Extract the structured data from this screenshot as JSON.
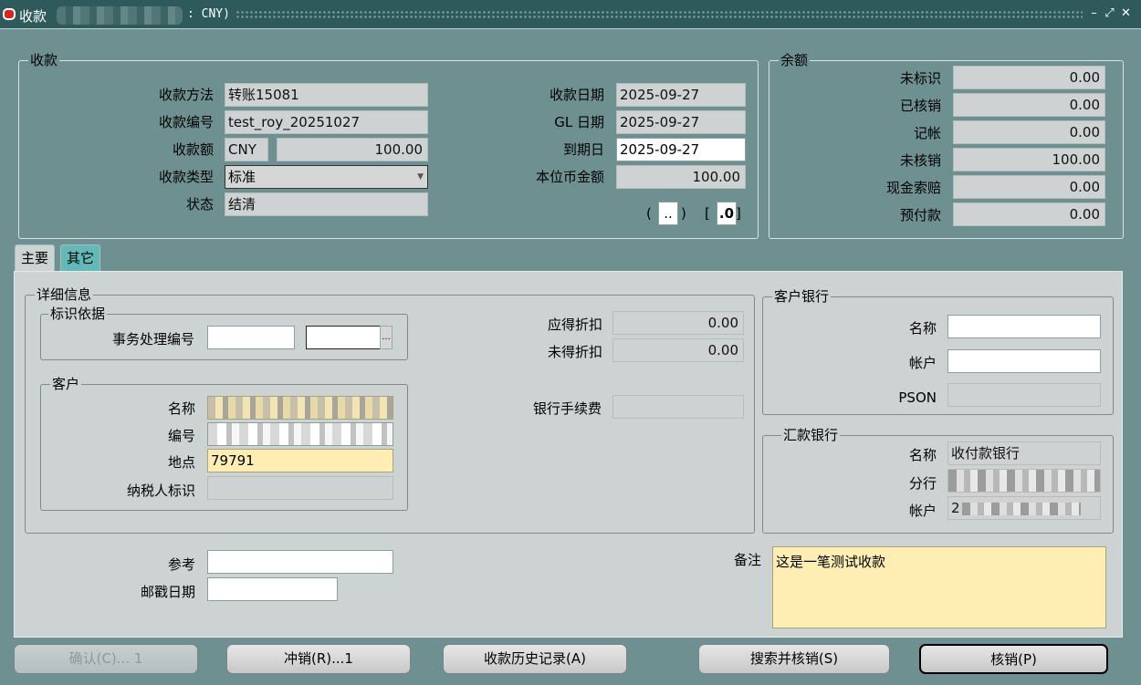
{
  "window": {
    "title": "收款",
    "title_suffix": ": CNY)",
    "controls": [
      "minimize-icon",
      "maximize-icon",
      "close-icon"
    ]
  },
  "receipt": {
    "legend": "收款",
    "method_label": "收款方法",
    "method_value": "转账15081",
    "number_label": "收款编号",
    "number_value": "test_roy_20251027",
    "amount_label": "收款额",
    "currency_value": "CNY",
    "amount_value": "100.00",
    "type_label": "收款类型",
    "type_value": "标准",
    "status_label": "状态",
    "status_value": "结清",
    "receipt_date_label": "收款日期",
    "receipt_date_value": "2025-09-27",
    "gl_date_label": "GL 日期",
    "gl_date_value": "2025-09-27",
    "maturity_date_label": "到期日",
    "maturity_date_value": "2025-09-27",
    "functional_amount_label": "本位币金额",
    "functional_amount_value": "100.00",
    "dff_open": "(",
    "dff_value": "..",
    "dff_close": ")",
    "dff2_open": "[",
    "dff2_value": ".0",
    "dff2_close": "]"
  },
  "balances": {
    "legend": "余额",
    "rows": [
      {
        "label": "未标识",
        "value": "0.00"
      },
      {
        "label": "已核销",
        "value": "0.00"
      },
      {
        "label": "记帐",
        "value": "0.00"
      },
      {
        "label": "未核销",
        "value": "100.00"
      },
      {
        "label": "现金索赔",
        "value": "0.00"
      },
      {
        "label": "预付款",
        "value": "0.00"
      }
    ]
  },
  "tabs": [
    {
      "label": "主要",
      "active": true
    },
    {
      "label": "其它",
      "active": false
    }
  ],
  "details": {
    "legend": "详细信息",
    "identification_legend": "标识依据",
    "transaction_number_label": "事务处理编号",
    "transaction_number_value": "",
    "transaction_number_value2": "",
    "lov_button": "...",
    "customer_legend": "客户",
    "customer_name_label": "名称",
    "customer_number_label": "编号",
    "customer_site_label": "地点",
    "customer_site_value": "79791",
    "taxpayer_label": "纳税人标识",
    "taxpayer_value": "",
    "earned_discount_label": "应得折扣",
    "earned_discount_value": "0.00",
    "unearned_discount_label": "未得折扣",
    "unearned_discount_value": "0.00",
    "bank_charges_label": "银行手续费",
    "bank_charges_value": ""
  },
  "customer_bank": {
    "legend": "客户银行",
    "name_label": "名称",
    "name_value": "",
    "account_label": "帐户",
    "account_value": "",
    "pson_label": "PSON",
    "pson_value": ""
  },
  "remittance_bank": {
    "legend": "汇款银行",
    "name_label": "名称",
    "name_value": "收付款银行",
    "branch_label": "分行",
    "account_label": "帐户",
    "account_value_prefix": "2"
  },
  "misc": {
    "reference_label": "参考",
    "reference_value": "",
    "postmark_label": "邮戳日期",
    "postmark_value": "",
    "comments_label": "备注",
    "comments_value": "这是一笔测试收款"
  },
  "buttons": [
    {
      "label": "确认(C)... 1",
      "enabled": false
    },
    {
      "label": "冲销(R)...1",
      "enabled": true
    },
    {
      "label": "收款历史记录(A)",
      "enabled": true
    },
    {
      "label": "搜索并核销(S)",
      "enabled": true
    },
    {
      "label": "核销(P)",
      "enabled": true
    }
  ],
  "colors": {
    "titlebar": "#2e5a5c",
    "window_bg": "#6e9090",
    "canvas_bg": "#cdd2d2",
    "required_field": "#ffeeb4",
    "inactive_tab": "#63b8b8"
  }
}
